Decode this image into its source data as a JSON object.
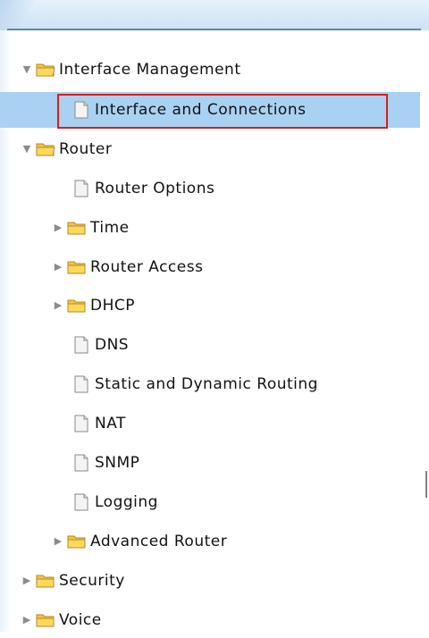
{
  "tree": {
    "items": [
      {
        "label": "Interface Management",
        "type": "folder",
        "state": "expanded",
        "icon": "folder-icon",
        "expander_icon": "triangle-down-icon"
      },
      {
        "label": "Interface and Connections",
        "type": "page",
        "icon": "page-icon",
        "selected": true
      },
      {
        "label": "Router",
        "type": "folder",
        "state": "expanded",
        "icon": "folder-icon",
        "expander_icon": "triangle-down-icon"
      },
      {
        "label": "Router Options",
        "type": "page",
        "icon": "page-icon"
      },
      {
        "label": "Time",
        "type": "folder",
        "state": "collapsed",
        "icon": "folder-icon",
        "expander_icon": "triangle-right-icon"
      },
      {
        "label": "Router Access",
        "type": "folder",
        "state": "collapsed",
        "icon": "folder-icon",
        "expander_icon": "triangle-right-icon"
      },
      {
        "label": "DHCP",
        "type": "folder",
        "state": "collapsed",
        "icon": "folder-icon",
        "expander_icon": "triangle-right-icon"
      },
      {
        "label": "DNS",
        "type": "page",
        "icon": "page-icon"
      },
      {
        "label": "Static and Dynamic Routing",
        "type": "page",
        "icon": "page-icon"
      },
      {
        "label": "NAT",
        "type": "page",
        "icon": "page-icon"
      },
      {
        "label": "SNMP",
        "type": "page",
        "icon": "page-icon"
      },
      {
        "label": "Logging",
        "type": "page",
        "icon": "page-icon"
      },
      {
        "label": "Advanced Router",
        "type": "folder",
        "state": "collapsed",
        "icon": "folder-icon",
        "expander_icon": "triangle-right-icon"
      },
      {
        "label": "Security",
        "type": "folder",
        "state": "collapsed",
        "icon": "folder-icon",
        "expander_icon": "triangle-right-icon"
      },
      {
        "label": "Voice",
        "type": "folder",
        "state": "collapsed",
        "icon": "folder-icon",
        "expander_icon": "triangle-right-icon"
      }
    ]
  },
  "colors": {
    "selected_row": "#a9d1f2",
    "highlight_border": "#e01b1b",
    "header_line": "#5b87b8",
    "folder_fill": "#f5c542",
    "text": "#121212"
  }
}
